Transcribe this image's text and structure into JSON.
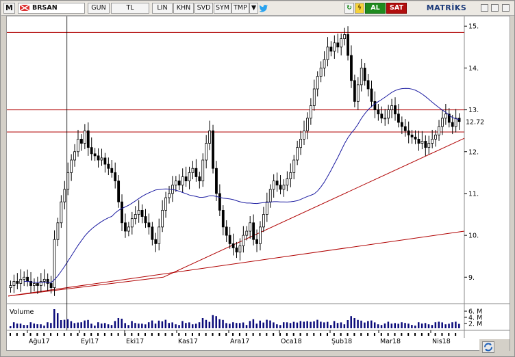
{
  "toolbar": {
    "logo": "M",
    "symbol": "BRSAN",
    "gun": "GUN",
    "currency": "TL",
    "lin": "LIN",
    "khn": "KHN",
    "svd": "SVD",
    "sym": "SYM",
    "tmp": "TMP",
    "dropdown": "▼",
    "twitter_icon": "twitter-icon",
    "refresh": "↻",
    "bolt": "ϟ",
    "buy": "AL",
    "sell": "SAT",
    "brand": "MATRİKS"
  },
  "colors": {
    "candle": "#000000",
    "horizontal_lines": "#b00000",
    "trend_lines": "#b00000",
    "moving_average": "#1a1aa0",
    "volume": "#0a0a7a",
    "crosshair": "#000000"
  },
  "chart_data": {
    "type": "candlestick",
    "symbol": "BRSAN",
    "y_ticks": [
      9,
      10,
      11,
      12,
      13,
      14,
      15
    ],
    "ylim": [
      8.4,
      15.2
    ],
    "last_price_label": "12.72",
    "months": [
      "Ağu17",
      "Eyl17",
      "Eki17",
      "Kas17",
      "Ara17",
      "Oca18",
      "Şub18",
      "Mar18",
      "Nis18"
    ],
    "horizontal_levels": [
      14.85,
      13.0,
      12.47
    ],
    "trend_lines": [
      {
        "from_x": 0.0,
        "from_price": 8.55,
        "to_x": 1.0,
        "to_price": 10.1
      },
      {
        "from_x": 0.0,
        "from_price": 8.55,
        "to_x": 0.34,
        "to_price": 9.0,
        "note": ""
      },
      {
        "from_x": 0.34,
        "from_price": 9.0,
        "to_x": 1.0,
        "to_price": 12.32
      }
    ],
    "volume_label": "Volume",
    "volume_ticks": [
      "6. M",
      "4. M",
      "2. M"
    ],
    "close_series": [
      8.8,
      8.9,
      8.85,
      8.95,
      9.0,
      8.9,
      8.8,
      8.85,
      8.8,
      8.9,
      8.95,
      8.85,
      8.75,
      9.9,
      10.3,
      10.8,
      11.1,
      11.5,
      11.8,
      12.0,
      12.3,
      12.2,
      12.5,
      12.1,
      11.95,
      11.9,
      11.8,
      11.85,
      11.7,
      11.6,
      11.5,
      11.3,
      10.8,
      10.3,
      10.1,
      10.2,
      10.4,
      10.5,
      10.6,
      10.45,
      10.3,
      10.2,
      9.9,
      9.8,
      10.2,
      10.6,
      10.9,
      11.0,
      11.2,
      11.3,
      11.2,
      11.4,
      11.3,
      11.5,
      11.6,
      11.4,
      11.3,
      11.8,
      12.2,
      12.5,
      11.6,
      11.0,
      10.6,
      10.2,
      10.0,
      9.8,
      9.7,
      9.6,
      9.75,
      10.0,
      10.1,
      10.3,
      9.9,
      9.8,
      10.2,
      10.5,
      10.8,
      11.1,
      11.3,
      11.2,
      11.1,
      11.2,
      11.35,
      11.5,
      11.8,
      12.1,
      12.3,
      12.5,
      12.8,
      13.1,
      13.5,
      13.8,
      14.0,
      14.2,
      14.5,
      14.4,
      14.6,
      14.5,
      14.7,
      14.8,
      14.3,
      13.7,
      13.2,
      13.6,
      14.0,
      13.7,
      13.5,
      13.2,
      13.0,
      12.9,
      12.8,
      12.8,
      13.0,
      13.1,
      12.9,
      12.7,
      12.6,
      12.5,
      12.4,
      12.35,
      12.3,
      12.2,
      12.25,
      12.1,
      12.2,
      12.3,
      12.4,
      12.6,
      12.8,
      12.9,
      12.7,
      12.6,
      12.8,
      12.72
    ]
  },
  "bottom": {
    "refresh_icon": "refresh-icon"
  }
}
